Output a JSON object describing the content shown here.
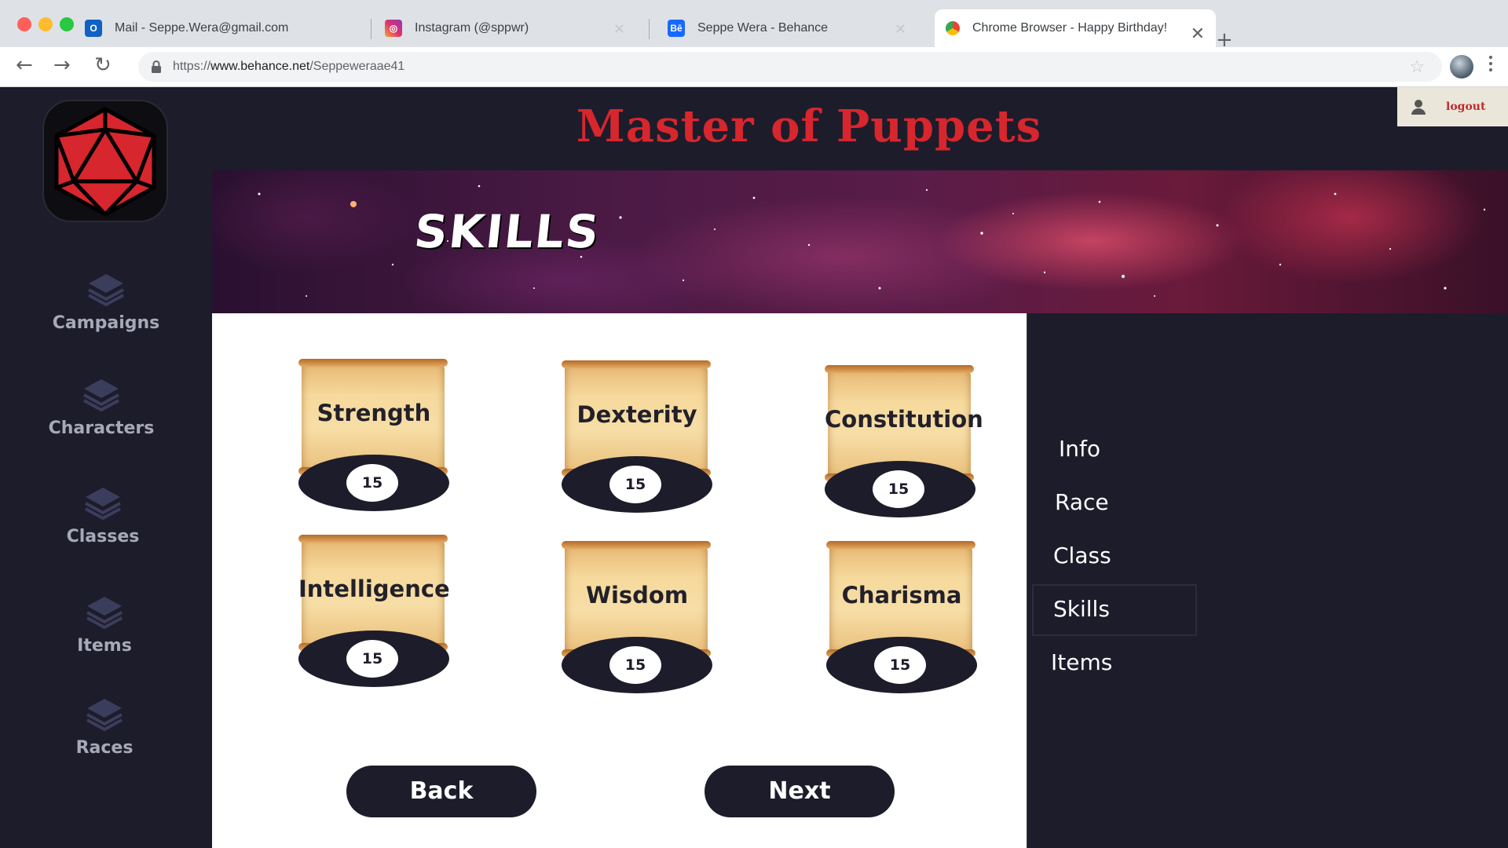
{
  "browser": {
    "tabs": [
      {
        "title": "Mail - Seppe.Wera@gmail.com",
        "icon": "outlook-icon"
      },
      {
        "title": "Instagram (@sppwr)",
        "icon": "instagram-icon"
      },
      {
        "title": "Seppe Wera - Behance",
        "icon": "behance-icon"
      },
      {
        "title": "Chrome Browser - Happy Birthday!",
        "icon": "chrome-icon"
      }
    ],
    "url_scheme": "https://",
    "url_host": "www.behance.net",
    "url_path": "/Seppeweraae41"
  },
  "app": {
    "title": "Master of Puppets",
    "logout_label": "logout",
    "banner_title": "SKILLS",
    "sidebar": [
      {
        "label": "Campaigns",
        "icon": "layers-icon"
      },
      {
        "label": "Characters",
        "icon": "layers-icon"
      },
      {
        "label": "Classes",
        "icon": "layers-icon"
      },
      {
        "label": "Items",
        "icon": "layers-icon"
      },
      {
        "label": "Races",
        "icon": "layers-icon"
      }
    ],
    "skills": [
      {
        "name": "Strength",
        "value": "15"
      },
      {
        "name": "Dexterity",
        "value": "15"
      },
      {
        "name": "Constitution",
        "value": "15"
      },
      {
        "name": "Intelligence",
        "value": "15"
      },
      {
        "name": "Wisdom",
        "value": "15"
      },
      {
        "name": "Charisma",
        "value": "15"
      }
    ],
    "buttons": {
      "back": "Back",
      "next": "Next"
    },
    "steps": [
      "Info",
      "Race",
      "Class",
      "Skills",
      "Items"
    ],
    "active_step": "Skills"
  },
  "colors": {
    "accent_red": "#d7262d",
    "dark_navy": "#1d1c2b",
    "sidebar_text": "#a6a9b8"
  }
}
